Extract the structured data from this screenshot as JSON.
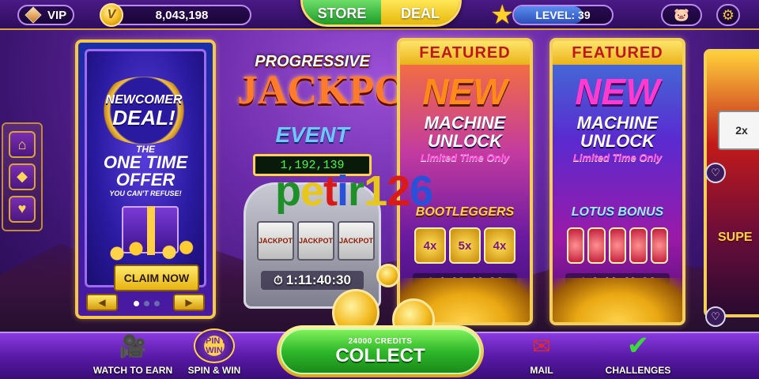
{
  "topbar": {
    "vip_label": "VIP",
    "coin_symbol": "V",
    "coins": "8,043,198",
    "store_label": "STORE",
    "deal_label": "DEAL",
    "level_label": "LEVEL: 39",
    "level_progress": 0.7,
    "icons": [
      "diamond-icon",
      "coin-icon",
      "star-icon",
      "piggy-bank-icon",
      "gear-icon"
    ]
  },
  "sidebar": {
    "items": [
      {
        "name": "home",
        "icon": "house-icon",
        "glyph": "⌂"
      },
      {
        "name": "gems",
        "icon": "diamond-icon",
        "glyph": "◆"
      },
      {
        "name": "favorites",
        "icon": "heart-icon",
        "glyph": "♥"
      }
    ]
  },
  "newcomer": {
    "line1": "NEWCOMER",
    "line2": "DEAL!",
    "offer_the": "THE",
    "offer_one": "ONE TIME",
    "offer_offer": "OFFER",
    "offer_sub": "YOU CAN'T REFUSE!",
    "claim_label": "CLAIM NOW",
    "prev_glyph": "◀",
    "next_glyph": "▶",
    "page_count": 3,
    "active_page": 0
  },
  "jackpot": {
    "progressive": "PROGRESSIVE",
    "jackpot": "JACKPOT",
    "event": "EVENT",
    "value": "1,192,139",
    "reels": [
      "JACKPOT",
      "JACKPOT",
      "JACKPOT"
    ],
    "timer": "1:11:40:30"
  },
  "featured": [
    {
      "header": "FEATURED",
      "new": "NEW",
      "machine": "MACHINE",
      "unlock": "UNLOCK",
      "limited": "Limited Time Only",
      "game": "BOOTLEGGERS",
      "reels": [
        "4x",
        "5x",
        "4x"
      ],
      "timer": "1:11:40:30"
    },
    {
      "header": "FEATURED",
      "new": "NEW",
      "machine": "MACHINE",
      "unlock": "UNLOCK",
      "limited": "Limited Time Only",
      "game": "LOTUS BONUS",
      "reels": [
        "",
        "",
        "",
        "",
        ""
      ],
      "timer": "1:11:40:30"
    }
  ],
  "partial_card": {
    "reel_text": "2x",
    "super_text": "SUPE"
  },
  "timer_icon": "⏱",
  "heart_glyph": "♡",
  "watermark": {
    "text": "petir126",
    "colors": [
      "#1f8f2a",
      "#e8c61a",
      "#d81a1a",
      "#2a4fd8",
      "#1f8f2a",
      "#e8c61a",
      "#d81a1a",
      "#2a4fd8"
    ]
  },
  "bottombar": {
    "watch_label": "WATCH TO EARN",
    "watch_icon": "🎥",
    "spin_label": "SPIN & WIN",
    "spin_icon_text": "SPIN & WIN",
    "collect_credits": "24000 CREDITS",
    "collect_label": "COLLECT",
    "mail_label": "MAIL",
    "mail_icon": "✉",
    "challenges_label": "CHALLENGES",
    "challenges_icon": "✔"
  }
}
